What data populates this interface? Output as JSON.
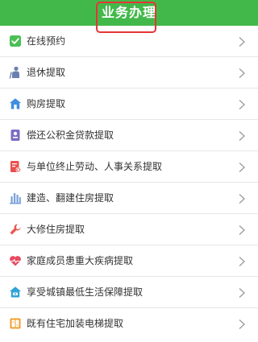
{
  "header": {
    "title": "业务办理",
    "color": "#43b84a"
  },
  "items": [
    {
      "label": "在线预约",
      "icon": "checkbox-icon"
    },
    {
      "label": "退休提取",
      "icon": "retiree-icon"
    },
    {
      "label": "购房提取",
      "icon": "house-icon"
    },
    {
      "label": "偿还公积金贷款提取",
      "icon": "loan-repay-icon"
    },
    {
      "label": "与单位终止劳动、人事关系提取",
      "icon": "contract-termination-icon"
    },
    {
      "label": "建造、翻建住房提取",
      "icon": "building-icon"
    },
    {
      "label": "大修住房提取",
      "icon": "repair-icon"
    },
    {
      "label": "家庭成员患重大疾病提取",
      "icon": "heart-pulse-icon"
    },
    {
      "label": "享受城镇最低生活保障提取",
      "icon": "house-subsidy-icon"
    },
    {
      "label": "既有住宅加装电梯提取",
      "icon": "elevator-icon"
    }
  ]
}
